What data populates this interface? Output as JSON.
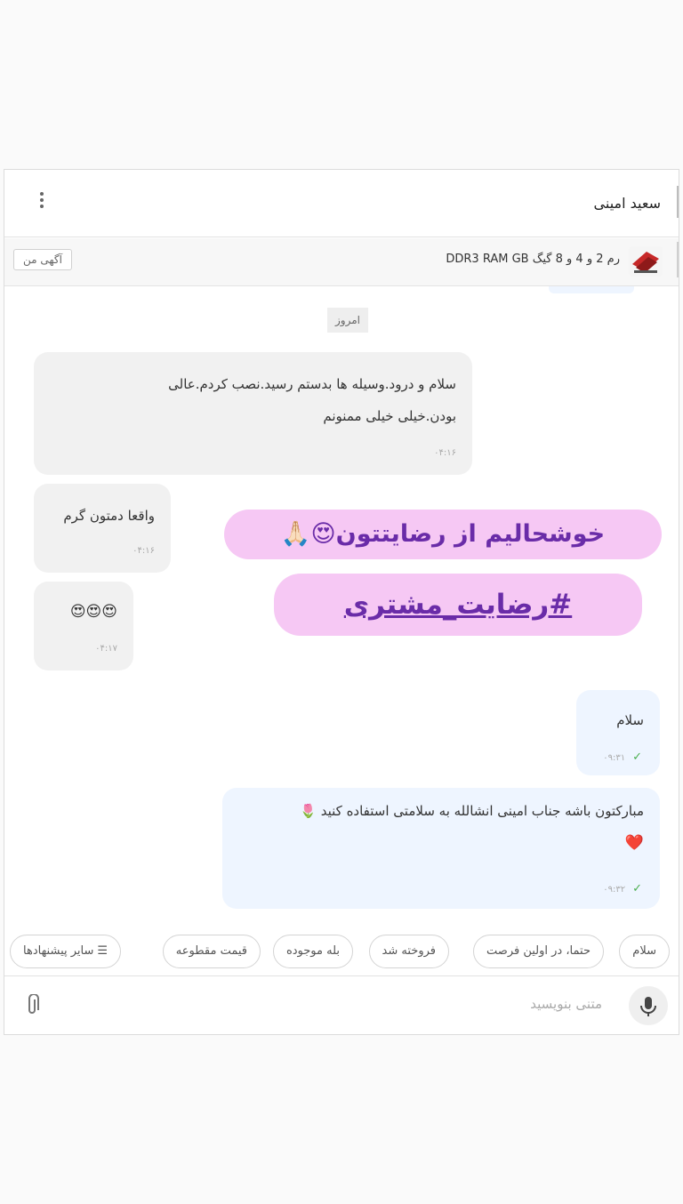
{
  "header": {
    "contact_name": "سعید امینی"
  },
  "ad": {
    "title": "رم 2 و 4 و 8 گیگ DDR3 RAM GB",
    "my_ad_label": "آگهی من"
  },
  "day_label": "امروز",
  "messages": [
    {
      "text_line1": "سلام و درود.وسیله ها بدستم رسید.نصب کردم.عالی",
      "text_line2": "بودن.خیلی خیلی ممنونم",
      "time": "۰۴:۱۶"
    },
    {
      "text": "واقعا دمتون گرم",
      "time": "۰۴:۱۶"
    },
    {
      "text": "😍😍😍",
      "time": "۰۴:۱۷"
    },
    {
      "text": "سلام",
      "time": "۰۹:۳۱"
    },
    {
      "text_line1": "مباركتون باشه جناب امینی انشالله به سلامتی استفاده كنيد 🌷",
      "text_line2": "❤️",
      "time": "۰۹:۳۲"
    }
  ],
  "overlay": {
    "line1": "خوشحالیم از رضایتتون😍🙏🏻",
    "line2": "#رضایت_مشتری"
  },
  "quick_replies": [
    "سلام",
    "حتما، در اولین فرصت",
    "فروخته شد",
    "بله موجوده",
    "قیمت مقطوعه",
    "سایر پیشنهادها"
  ],
  "composer": {
    "placeholder": "متنی بنویسید"
  },
  "colors": {
    "outgoing_bubble": "#eef5ff",
    "incoming_bubble": "#f1f1f1",
    "overlay_pill": "#f6c8f4",
    "overlay_text": "#6a2ca8",
    "check": "#4caf50"
  },
  "icons": {
    "more": "more-vert-icon",
    "mic": "mic-icon",
    "attach": "paperclip-icon",
    "suggest": "list-icon",
    "read": "check-icon"
  }
}
